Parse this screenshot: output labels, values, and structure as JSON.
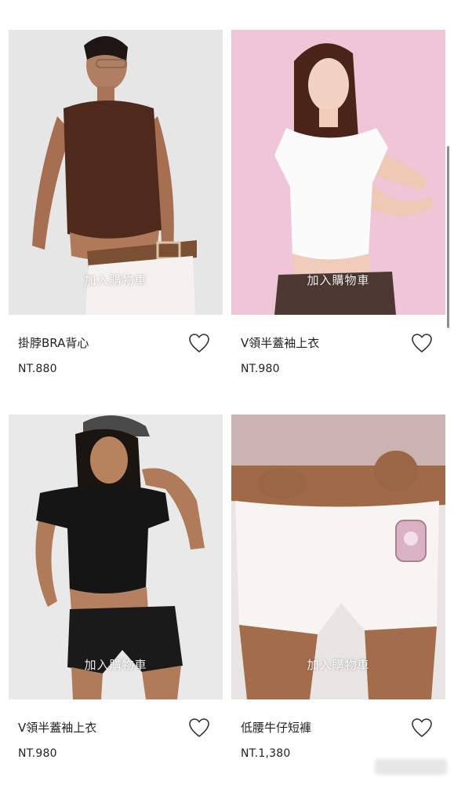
{
  "products": [
    {
      "name": "掛脖BRA背心",
      "price": "NT.880",
      "add_to_cart": "加入購物車",
      "favorite_icon": "heart-outline-icon",
      "image": "model-brown-halter-top",
      "background_color": "#e6e6e6"
    },
    {
      "name": "V領半蓋袖上衣",
      "price": "NT.980",
      "add_to_cart": "加入購物車",
      "favorite_icon": "heart-outline-icon",
      "image": "model-white-top-pink-background",
      "background_color": "#efc6d8"
    },
    {
      "name": "V領半蓋袖上衣",
      "price": "NT.980",
      "add_to_cart": "加入購物車",
      "favorite_icon": "heart-outline-icon",
      "image": "model-black-top-cap",
      "background_color": "#e9e9e9"
    },
    {
      "name": "低腰牛仔短褲",
      "price": "NT.1,380",
      "add_to_cart": "加入購物車",
      "favorite_icon": "heart-outline-icon",
      "image": "model-white-denim-shorts",
      "background_color": "#e8e6e3"
    }
  ]
}
